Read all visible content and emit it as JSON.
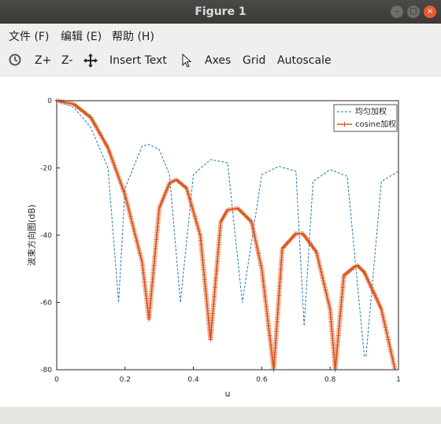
{
  "window": {
    "title": "Figure 1"
  },
  "menu": {
    "file": "文件 (F)",
    "edit": "编辑 (E)",
    "help": "帮助 (H)"
  },
  "toolbar": {
    "zoom_in": "Z+",
    "zoom_out": "Z-",
    "insert_text": "Insert Text",
    "axes": "Axes",
    "grid": "Grid",
    "autoscale": "Autoscale"
  },
  "colors": {
    "series_uniform": "#1f77b4",
    "series_cosine": "#d95319"
  },
  "chart_data": {
    "type": "line",
    "xlabel": "u",
    "ylabel": "波束方向图(dB)",
    "xlim": [
      0,
      1
    ],
    "ylim": [
      -80,
      0
    ],
    "xticks": [
      "0",
      "0.2",
      "0.4",
      "0.6",
      "0.8",
      "1"
    ],
    "yticks": [
      "0",
      "-20",
      "-40",
      "-60",
      "-80"
    ],
    "grid": false,
    "legend_position": "top-right",
    "series": [
      {
        "name": "均匀加权",
        "style": "dashed",
        "x": [
          0,
          0.05,
          0.1,
          0.15,
          0.181,
          0.2,
          0.25,
          0.27,
          0.3,
          0.33,
          0.362,
          0.4,
          0.45,
          0.5,
          0.543,
          0.6,
          0.65,
          0.7,
          0.724,
          0.75,
          0.8,
          0.85,
          0.9,
          0.905,
          0.95,
          1.0
        ],
        "y": [
          0,
          -2,
          -8,
          -20,
          -60,
          -26,
          -13.5,
          -13,
          -14.5,
          -22,
          -60,
          -22,
          -17.5,
          -18.5,
          -60,
          -22,
          -19.5,
          -21,
          -67,
          -24,
          -20.5,
          -22.5,
          -76,
          -76,
          -24,
          -21
        ]
      },
      {
        "name": "cosine加权",
        "style": "solid-plus",
        "x": [
          0,
          0.05,
          0.1,
          0.15,
          0.2,
          0.25,
          0.27,
          0.3,
          0.33,
          0.35,
          0.38,
          0.42,
          0.45,
          0.48,
          0.5,
          0.53,
          0.57,
          0.6,
          0.635,
          0.66,
          0.7,
          0.72,
          0.76,
          0.8,
          0.815,
          0.84,
          0.87,
          0.88,
          0.9,
          0.95,
          0.99
        ],
        "y": [
          0,
          -1,
          -5,
          -14,
          -28,
          -48,
          -65,
          -32,
          -24.5,
          -23.5,
          -26,
          -40,
          -71,
          -36,
          -32.5,
          -32,
          -36,
          -50,
          -80,
          -44,
          -39.5,
          -39.5,
          -45,
          -62,
          -80,
          -52,
          -49.5,
          -49,
          -51,
          -62,
          -80
        ]
      }
    ]
  }
}
